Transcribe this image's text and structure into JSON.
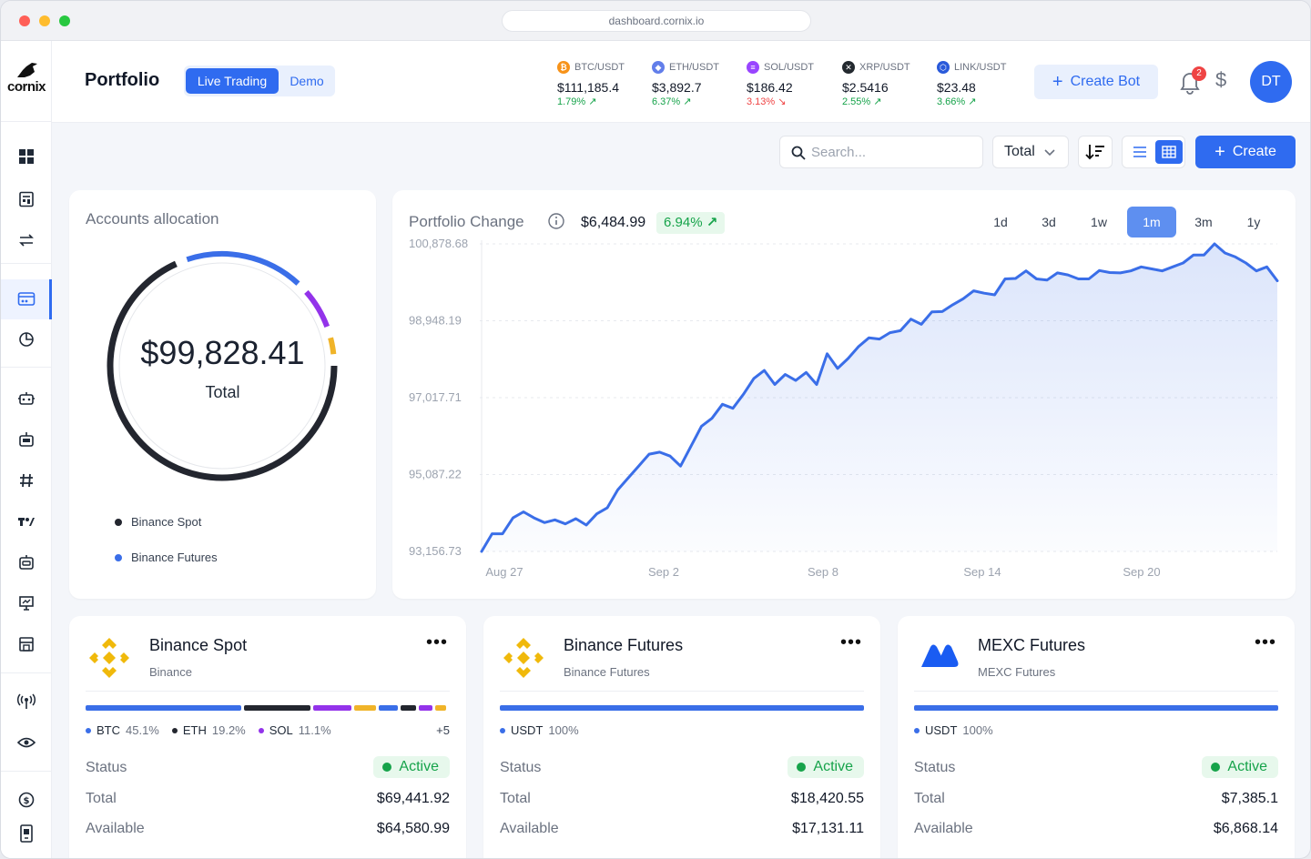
{
  "browser": {
    "url": "dashboard.cornix.io"
  },
  "app": {
    "logo_text": "cornix"
  },
  "header": {
    "title": "Portfolio",
    "mode_live": "Live Trading",
    "mode_demo": "Demo",
    "create_bot_label": "Create Bot",
    "notification_count": "2",
    "avatar_initials": "DT"
  },
  "tickers": [
    {
      "pair": "BTC/USDT",
      "price": "$111,185.4",
      "change": "1.79%",
      "direction": "up",
      "icon": "bitcoin-icon",
      "color": "#f7931a",
      "glyph": "₿"
    },
    {
      "pair": "ETH/USDT",
      "price": "$3,892.7",
      "change": "6.37%",
      "direction": "up",
      "icon": "ethereum-icon",
      "color": "#627eea",
      "glyph": "◆"
    },
    {
      "pair": "SOL/USDT",
      "price": "$186.42",
      "change": "3.13%",
      "direction": "down",
      "icon": "solana-icon",
      "color": "#9945ff",
      "glyph": "≡"
    },
    {
      "pair": "XRP/USDT",
      "price": "$2.5416",
      "change": "2.55%",
      "direction": "up",
      "icon": "xrp-icon",
      "color": "#23292f",
      "glyph": "✕"
    },
    {
      "pair": "LINK/USDT",
      "price": "$23.48",
      "change": "3.66%",
      "direction": "up",
      "icon": "chainlink-icon",
      "color": "#2a5ada",
      "glyph": "⬡"
    }
  ],
  "toolbar": {
    "search_placeholder": "Search...",
    "total_select": "Total",
    "create_label": "Create"
  },
  "allocation": {
    "title": "Accounts allocation",
    "total_value": "$99,828.41",
    "total_label": "Total",
    "legend": [
      {
        "label": "Binance Spot",
        "color": "#23262f"
      },
      {
        "label": "Binance Futures",
        "color": "#3a6ee8"
      }
    ],
    "segments": [
      {
        "account": "Binance Spot",
        "fraction": 0.695,
        "color": "#23262f"
      },
      {
        "account": "Binance Futures",
        "fraction": 0.185,
        "color": "#3a6ee8"
      },
      {
        "account": "MEXC Futures",
        "fraction": 0.074,
        "color": "#9333ea"
      },
      {
        "account": "Other",
        "fraction": 0.04,
        "color": "#f0b429"
      }
    ]
  },
  "portfolio_change": {
    "title": "Portfolio Change",
    "value": "$6,484.99",
    "change_pct": "6.94%",
    "ranges": [
      "1d",
      "3d",
      "1w",
      "1m",
      "3m",
      "1y"
    ],
    "active_range": "1m"
  },
  "chart_data": {
    "type": "area",
    "title": "Portfolio Change",
    "y_ticks": [
      "100,878.68",
      "98,948.19",
      "97,017.71",
      "95,087.22",
      "93,156.73"
    ],
    "ylim": [
      93156.73,
      100878.68
    ],
    "x_ticks": [
      "Aug 27",
      "Sep 2",
      "Sep 8",
      "Sep 14",
      "Sep 20"
    ],
    "x_tick_index": [
      0,
      6,
      12,
      18,
      24
    ],
    "color": "#3a6ee8",
    "values": [
      93156.7,
      93600,
      93600,
      94000,
      94150,
      94000,
      93880,
      93950,
      93850,
      93980,
      93820,
      94100,
      94250,
      94700,
      95000,
      95300,
      95600,
      95650,
      95550,
      95300,
      95800,
      96300,
      96500,
      96850,
      96750,
      97100,
      97500,
      97700,
      97350,
      97600,
      97450,
      97650,
      97350,
      98120,
      97750,
      98000,
      98300,
      98520,
      98490,
      98650,
      98700,
      98990,
      98860,
      99170,
      99180,
      99350,
      99500,
      99700,
      99640,
      99600,
      100000,
      100010,
      100200,
      100000,
      99970,
      100150,
      100100,
      100000,
      100000,
      100210,
      100160,
      100150,
      100200,
      100300,
      100250,
      100200,
      100300,
      100400,
      100600,
      100600,
      100878.7,
      100650,
      100550,
      100400,
      100200,
      100300,
      99950
    ]
  },
  "accounts": [
    {
      "name": "Binance Spot",
      "sub": "Binance",
      "logo": "binance-logo-icon",
      "assets": [
        {
          "label": "BTC",
          "pct": "45.1%",
          "color": "#3a6ee8"
        },
        {
          "label": "ETH",
          "pct": "19.2%",
          "color": "#23262f"
        },
        {
          "label": "SOL",
          "pct": "11.1%",
          "color": "#9333ea"
        }
      ],
      "more": "+5",
      "bar": [
        {
          "fraction": 0.451,
          "color": "#3a6ee8"
        },
        {
          "fraction": 0.192,
          "color": "#23262f"
        },
        {
          "fraction": 0.111,
          "color": "#9333ea"
        },
        {
          "fraction": 0.065,
          "color": "#f0b429"
        },
        {
          "fraction": 0.055,
          "color": "#3a6ee8"
        },
        {
          "fraction": 0.045,
          "color": "#23262f"
        },
        {
          "fraction": 0.04,
          "color": "#9333ea"
        },
        {
          "fraction": 0.03,
          "color": "#f0b429"
        }
      ],
      "status_label": "Status",
      "status": "Active",
      "total_label": "Total",
      "total": "$69,441.92",
      "available_label": "Available",
      "available": "$64,580.99"
    },
    {
      "name": "Binance Futures",
      "sub": "Binance Futures",
      "logo": "binance-logo-icon",
      "assets": [
        {
          "label": "USDT",
          "pct": "100%",
          "color": "#3a6ee8"
        }
      ],
      "more": "",
      "bar": [
        {
          "fraction": 1,
          "color": "#3a6ee8"
        }
      ],
      "status_label": "Status",
      "status": "Active",
      "total_label": "Total",
      "total": "$18,420.55",
      "available_label": "Available",
      "available": "$17,131.11"
    },
    {
      "name": "MEXC Futures",
      "sub": "MEXC Futures",
      "logo": "mexc-logo-icon",
      "assets": [
        {
          "label": "USDT",
          "pct": "100%",
          "color": "#3a6ee8"
        }
      ],
      "more": "",
      "bar": [
        {
          "fraction": 1,
          "color": "#3a6ee8"
        }
      ],
      "status_label": "Status",
      "status": "Active",
      "total_label": "Total",
      "total": "$7,385.1",
      "available_label": "Available",
      "available": "$6,868.14"
    }
  ]
}
